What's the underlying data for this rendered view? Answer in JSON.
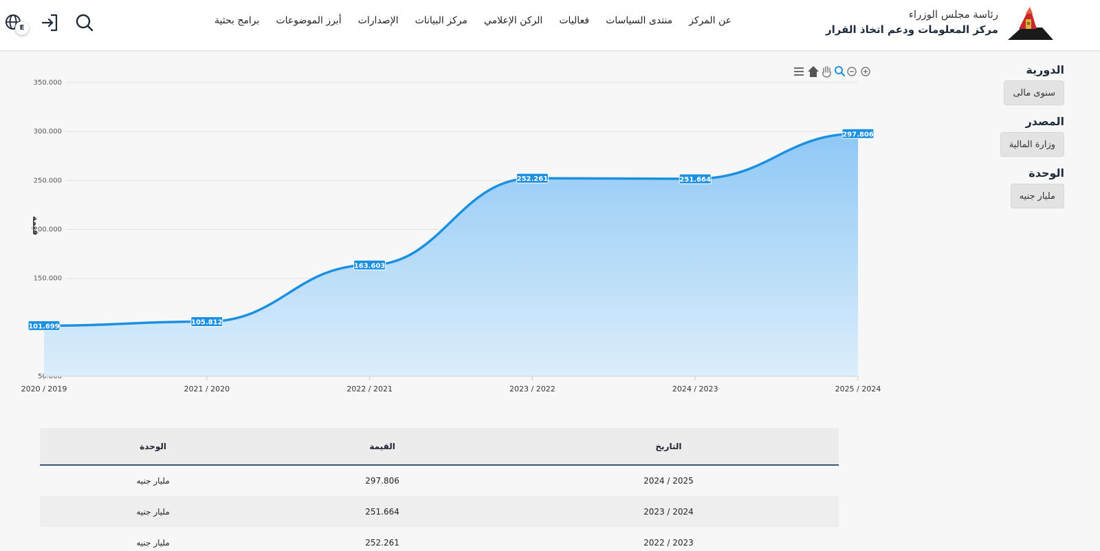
{
  "header": {
    "brand_line1": "رئاسة مجلس الوزراء",
    "brand_line2": "مركز المعلومات ودعم اتخاذ القرار",
    "nav": [
      "برامج بحثية",
      "أبرز الموضوعات",
      "الإصدارات",
      "مركز البيانات",
      "الركن الإعلامي",
      "فعاليات",
      "منتدى السياسات",
      "عن المركز"
    ],
    "lang_label": "E",
    "icons": [
      "search-icon",
      "login-icon",
      "globe-icon"
    ]
  },
  "filters": [
    {
      "label": "الدورية",
      "value": "سنوى مالى"
    },
    {
      "label": "المصدر",
      "value": "وزارة المالية"
    },
    {
      "label": "الوحدة",
      "value": "مليار جنيه"
    }
  ],
  "chart_toolbar": [
    "zoom-in-icon",
    "zoom-out-icon",
    "zoom-selection-icon",
    "pan-icon",
    "reset-home-icon",
    "menu-icon"
  ],
  "chart_data": {
    "type": "area",
    "categories": [
      "2020 / 2019",
      "2021 / 2020",
      "2022 / 2021",
      "2023 / 2022",
      "2024 / 2023",
      "2025 / 2024"
    ],
    "series": [
      {
        "values": [
          101.699,
          105.812,
          163.603,
          252.261,
          251.664,
          297.806
        ]
      }
    ],
    "data_labels": [
      "101.699",
      "105.812",
      "163.603",
      "252.261",
      "251.664",
      "297.806"
    ],
    "y_ticks": [
      "50.000",
      "150.000",
      "200.000",
      "250.000",
      "300.000",
      "350.000"
    ],
    "y_tick_values": [
      50,
      150,
      200,
      250,
      300,
      350
    ],
    "ylim": [
      50,
      350
    ],
    "ylabel": "قيمة",
    "grid": true,
    "colors": {
      "line": "#1b8fe0",
      "fill_top": "#8fc8f5",
      "fill_bottom": "#dceefb",
      "label_bg": "#1b8fe0"
    }
  },
  "table": {
    "headers": [
      "التاريخ",
      "القيمة",
      "الوحدة"
    ],
    "rows": [
      [
        "2025 / 2024",
        "297.806",
        "مليار جنيه"
      ],
      [
        "2024 / 2023",
        "251.664",
        "مليار جنيه"
      ],
      [
        "2023 / 2022",
        "252.261",
        "مليار جنيه"
      ]
    ]
  }
}
